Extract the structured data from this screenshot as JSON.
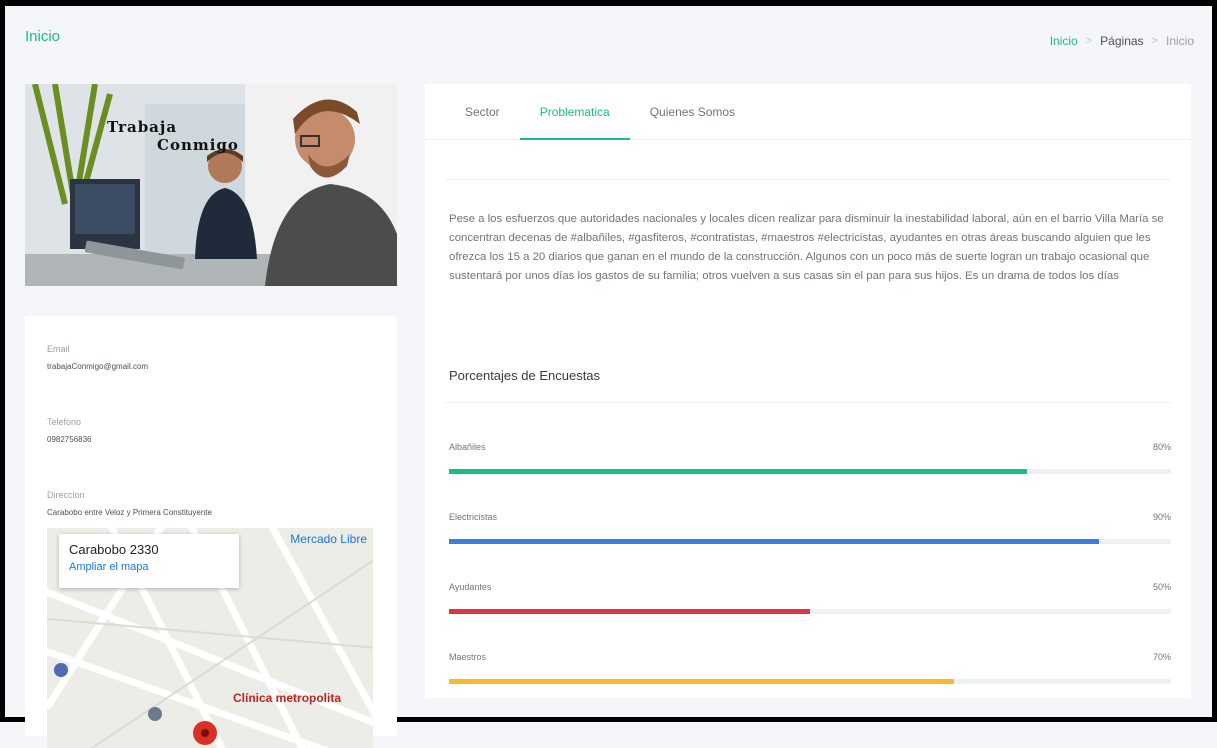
{
  "header": {
    "title": "Inicio",
    "breadcrumb": [
      "Inicio",
      "Páginas",
      "Inicio"
    ]
  },
  "hero": {
    "title_line1": "Trabaja",
    "title_line2": "Conmigo"
  },
  "contact": {
    "email_label": "Email",
    "email_value": "trabajaConmigo@gmail.com",
    "phone_label": "Telefono",
    "phone_value": "0982756836",
    "address_label": "Direccion",
    "address_value": "Carabobo entre Veloz y Primera Constituyente"
  },
  "map": {
    "place": "Carabobo 2330",
    "enlarge": "Ampliar el mapa",
    "market_label": "Mercado Libre",
    "clinic_label": "Clínica metropolita"
  },
  "tabs": [
    {
      "label": "Sector",
      "active": false
    },
    {
      "label": "Problematica",
      "active": true
    },
    {
      "label": "Quienes Somos",
      "active": false
    }
  ],
  "content": {
    "paragraph": "Pese a los esfuerzos que autoridades nacionales y locales dicen realizar para disminuir la inestabilidad laboral, aún en el barrio Villa María se concentran decenas de #albañiles, #gasfiteros, #contratistas, #maestros #electricistas, ayudantes en otras áreas buscando alguien que les ofrezca los 15 a 20 diarios que ganan en el mundo de la construcción. Algunos con un poco más de suerte logran un trabajo ocasional que sustentará por unos días los gastos de su familia; otros vuelven a sus casas sin el pan para sus hijos. Es un drama de todos los días",
    "survey_title": "Porcentajes de Encuestas"
  },
  "survey": [
    {
      "label": "Albañiles",
      "value": 80,
      "display": "80%",
      "color": "#1cbb8c"
    },
    {
      "label": "Electricistas",
      "value": 90,
      "display": "90%",
      "color": "#3b7ddd"
    },
    {
      "label": "Ayudantes",
      "value": 50,
      "display": "50%",
      "color": "#dc3545"
    },
    {
      "label": "Maestros",
      "value": 70,
      "display": "70%",
      "color": "#fcb92c"
    }
  ]
}
